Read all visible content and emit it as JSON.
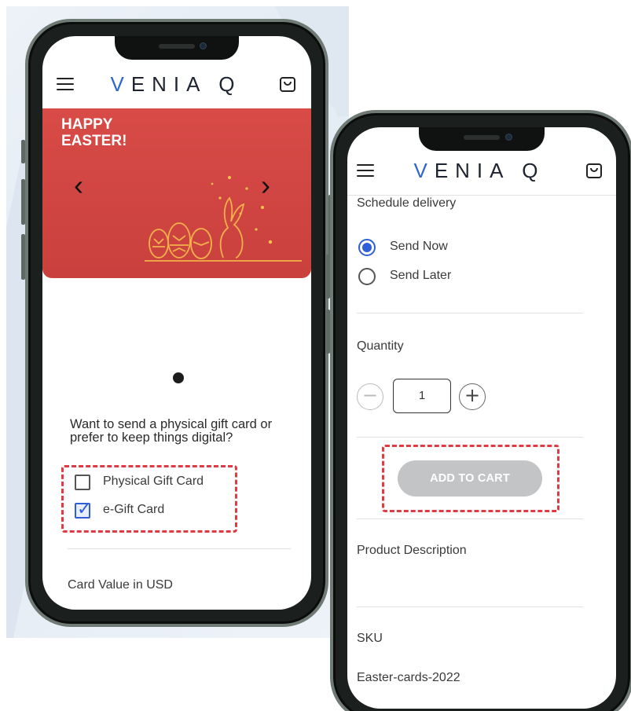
{
  "brand": {
    "logo_text": "VENIAQ",
    "accent": "#2f66c8"
  },
  "icons": {
    "menu": "hamburger-icon",
    "cart": "shopping-bag-icon",
    "prev": "chevron-left-icon",
    "next": "chevron-right-icon",
    "plus": "plus-icon",
    "minus": "minus-icon"
  },
  "left": {
    "banner": {
      "title": "HAPPY\nEASTER!",
      "color": "#d14642"
    },
    "carousel": {
      "prev": "‹",
      "next": "›",
      "active_dot": 1
    },
    "question": "Want to send a physical gift card or prefer to keep things digital?",
    "options": [
      {
        "label": "Physical Gift Card",
        "checked": false
      },
      {
        "label": "e-Gift Card",
        "checked": true
      }
    ],
    "card_value_label": "Card Value in USD"
  },
  "right": {
    "schedule": {
      "heading": "Schedule delivery",
      "options": [
        {
          "label": "Send Now",
          "checked": true
        },
        {
          "label": "Send Later",
          "checked": false
        }
      ]
    },
    "quantity": {
      "label": "Quantity",
      "value": "1",
      "minus": "−",
      "plus": "+"
    },
    "add_to_cart": "ADD TO CART",
    "description_heading": "Product Description",
    "sku_label": "SKU",
    "sku_value": "Easter-cards-2022"
  },
  "highlight_color": "#e03a43"
}
